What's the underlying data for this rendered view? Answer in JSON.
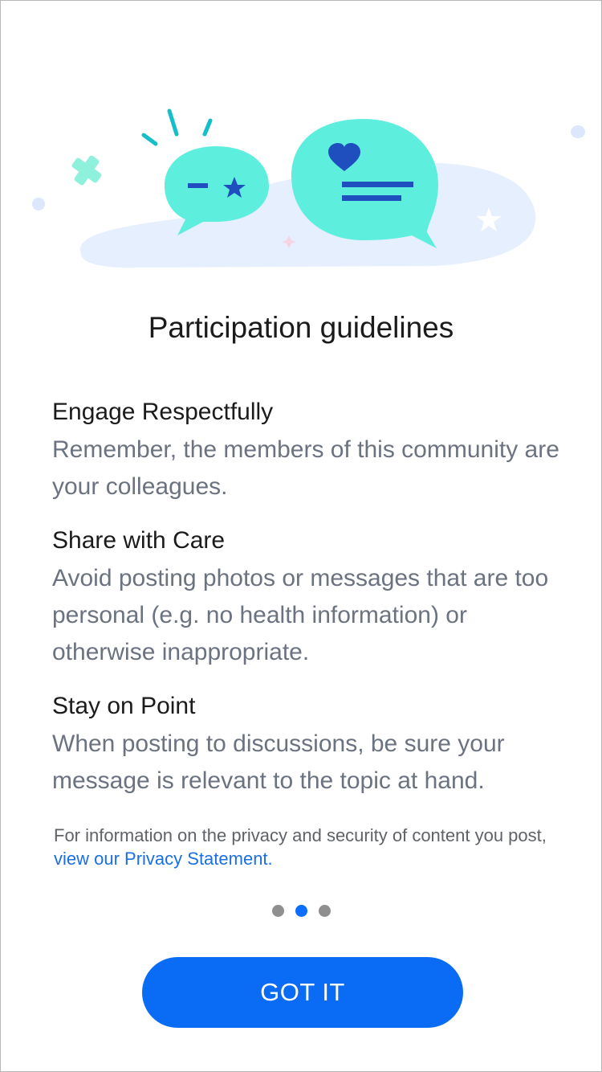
{
  "illustration": {
    "icons": [
      "chat-bubble-icon",
      "heart-icon",
      "star-icon",
      "sparkle-icon"
    ],
    "colors": {
      "bubble": "#5eeede",
      "blob": "#e6effd",
      "accent": "#0f3fa8",
      "ray": "#15bfc9"
    }
  },
  "title": "Participation guidelines",
  "sections": [
    {
      "heading": "Engage Respectfully",
      "body": "Remember, the members of this community are your colleagues."
    },
    {
      "heading": "Share with Care",
      "body": "Avoid posting photos or messages that are too personal (e.g. no health information) or otherwise inappropriate."
    },
    {
      "heading": "Stay on Point",
      "body": "When posting to discussions, be sure your message is relevant to the topic at hand."
    }
  ],
  "privacy": {
    "text": "For information on the privacy and security of content you post,",
    "link": "view our Privacy Statement."
  },
  "pagination": {
    "current": 2,
    "total": 3
  },
  "button": {
    "label": "GOT IT"
  },
  "colors": {
    "primary": "#0a6cf5",
    "dot_inactive": "#8f8f8f",
    "body_text": "#6b7280"
  }
}
